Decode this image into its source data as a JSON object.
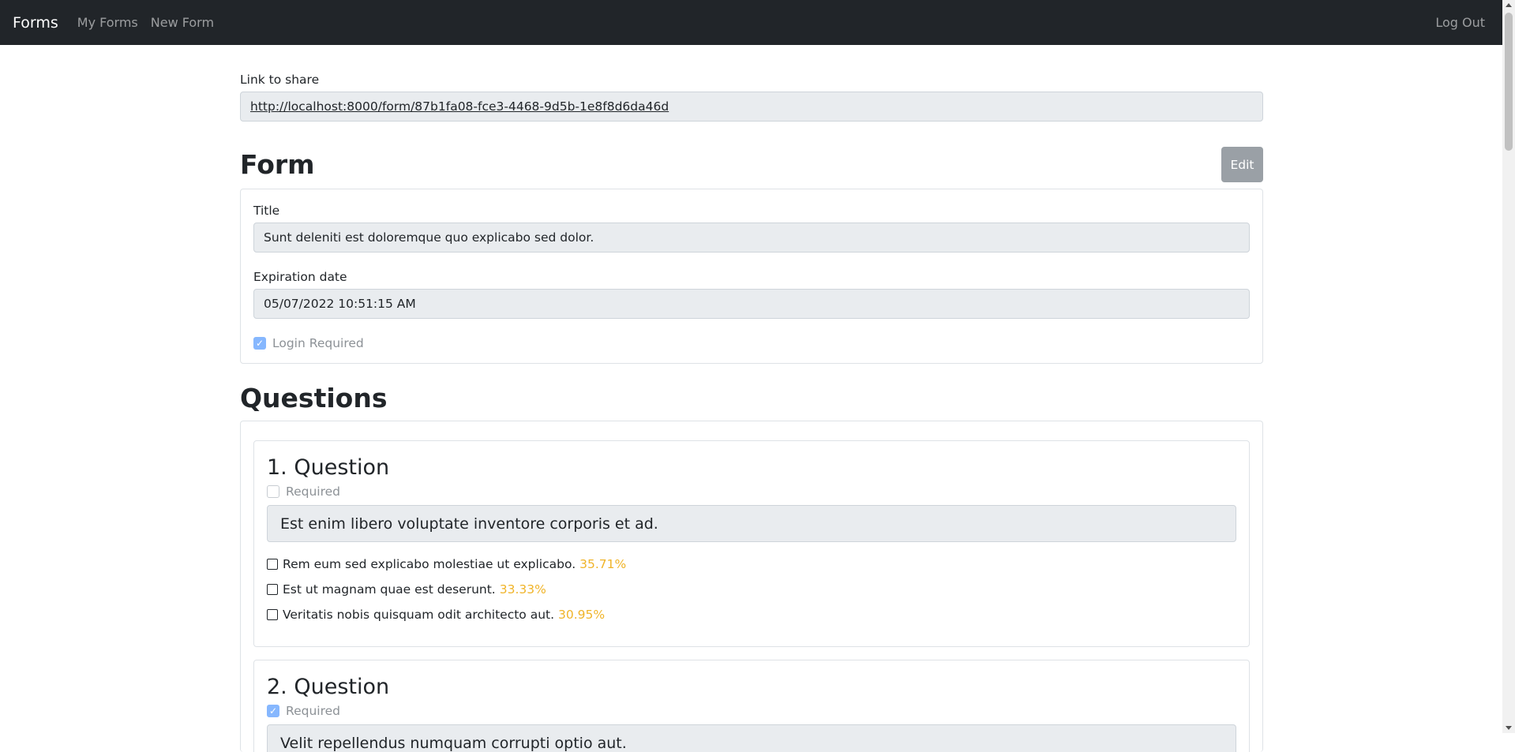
{
  "navbar": {
    "brand": "Forms",
    "links": [
      "My Forms",
      "New Form"
    ],
    "logout": "Log Out"
  },
  "share": {
    "label": "Link to share",
    "url": "http://localhost:8000/form/87b1fa08-fce3-4468-9d5b-1e8f8d6da46d"
  },
  "form": {
    "heading": "Form",
    "edit_label": "Edit",
    "title_label": "Title",
    "title_value": "Sunt deleniti est doloremque quo explicabo sed dolor.",
    "expiration_label": "Expiration date",
    "expiration_value": "05/07/2022 10:51:15 AM",
    "login_required_label": "Login Required",
    "login_required": true
  },
  "questions": {
    "heading": "Questions",
    "items": [
      {
        "title": "1. Question",
        "required_label": "Required",
        "required": false,
        "text": "Est enim libero voluptate inventore corporis et ad.",
        "options": [
          {
            "label": "Rem eum sed explicabo molestiae ut explicabo.",
            "percent": "35.71%"
          },
          {
            "label": "Est ut magnam quae est deserunt.",
            "percent": "33.33%"
          },
          {
            "label": "Veritatis nobis quisquam odit architecto aut.",
            "percent": "30.95%"
          }
        ]
      },
      {
        "title": "2. Question",
        "required_label": "Required",
        "required": true,
        "text": "Velit repellendus numquam corrupti optio aut.",
        "options": []
      }
    ]
  },
  "colors": {
    "navbar_bg": "#212529",
    "field_bg": "#e9ecef",
    "percent": "#f0b429",
    "checkbox_checked": "#86b7fe"
  }
}
